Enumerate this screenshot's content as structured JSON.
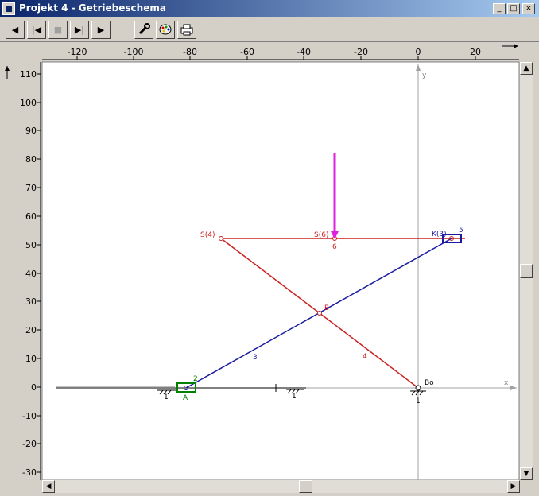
{
  "window": {
    "title": "Projekt 4 - Getriebeschema",
    "minimize_glyph": "_",
    "maximize_glyph": "□",
    "close_glyph": "×"
  },
  "toolbar": {
    "first_glyph": "◀",
    "rewind_glyph": "|◀",
    "stop_glyph": "■",
    "step_end_glyph": "▶|",
    "play_glyph": "▶",
    "settings_icon": "wrench-icon",
    "palette_icon": "palette-icon",
    "print_icon": "printer-icon"
  },
  "axes": {
    "x_ticks": [
      "-120",
      "-100",
      "-80",
      "-60",
      "-40",
      "-20",
      "0",
      "20"
    ],
    "y_ticks": [
      "110",
      "100",
      "90",
      "80",
      "70",
      "60",
      "50",
      "40",
      "30",
      "20",
      "10",
      "0",
      "-10",
      "-20",
      "-30"
    ],
    "x_axis_label": "x",
    "y_axis_label": "y"
  },
  "mechanism": {
    "labels": {
      "s4": "S(4)",
      "s6": "S(6)",
      "k3": "K(3)",
      "link5": "5",
      "link6": "6",
      "link3": "3",
      "link4": "4",
      "link2": "2",
      "point_a": "A",
      "point_b": "B",
      "point_bo": "Bo",
      "ground_1a": "1",
      "ground_1b": "1",
      "ground_1c": "1"
    },
    "colors": {
      "red_link": "#cc2020",
      "blue_link": "#1a1aa0",
      "force": "#e020e0",
      "slider_a": "#008000"
    }
  },
  "scrollbars": {
    "up_glyph": "▲",
    "down_glyph": "▼",
    "left_glyph": "◀",
    "right_glyph": "▶"
  }
}
